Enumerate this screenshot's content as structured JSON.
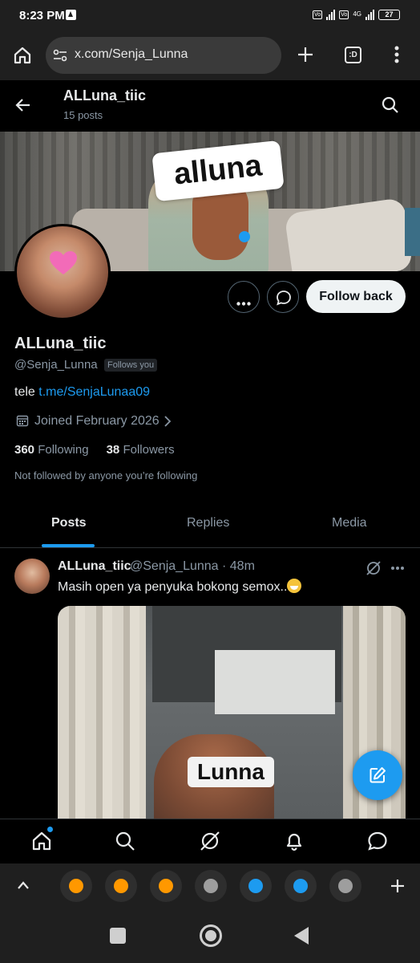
{
  "status_bar": {
    "time": "8:23 PM",
    "network": "4G",
    "battery": "27"
  },
  "browser": {
    "url": "x.com/Senja_Lunna",
    "tabs_label": ":D"
  },
  "profile_header": {
    "name": "ALLuna_tiic",
    "posts_count": "15 posts"
  },
  "banner": {
    "sticker_text": "alluna"
  },
  "actions": {
    "follow_label": "Follow back"
  },
  "profile": {
    "name": "ALLuna_tiic",
    "handle": "@Senja_Lunna",
    "follows_you_badge": "Follows you",
    "bio_prefix": "tele",
    "bio_link": "t.me/SenjaLunaa09",
    "joined": "Joined February 2026",
    "following_count": "360",
    "following_label": "Following",
    "followers_count": "38",
    "followers_label": "Followers",
    "mutuals_note": "Not followed by anyone you’re following"
  },
  "tabs": [
    {
      "label": "Posts",
      "active": true
    },
    {
      "label": "Replies",
      "active": false
    },
    {
      "label": "Media",
      "active": false
    }
  ],
  "post": {
    "author_name": "ALLuna_tiic",
    "meta": "@Senja_Lunna · 48m",
    "text": "Masih open ya penyuka bokong semox..",
    "emoji": "grinning-face",
    "media_label": "Lunna"
  },
  "colors": {
    "accent": "#1d9bf0",
    "background": "#000000",
    "muted_text": "#8b98a5",
    "browser_chrome": "#1f1f1f"
  },
  "tab_strip": {
    "tab_icons": [
      "orange-circle-icon",
      "orange-circle-icon",
      "orange-circle-icon",
      "globe-icon",
      "twitter-bird-icon",
      "twitter-bird-icon",
      "globe-icon"
    ]
  }
}
